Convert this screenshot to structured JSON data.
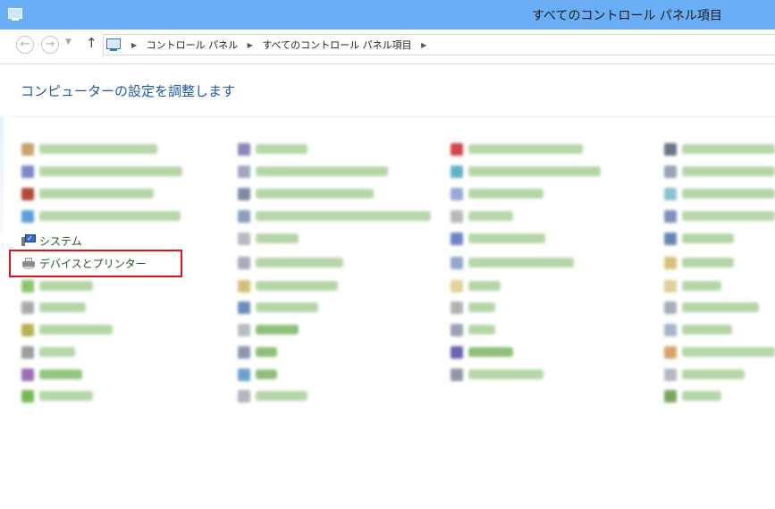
{
  "window": {
    "title": "すべてのコントロール パネル項目"
  },
  "nav": {
    "back_symbol": "←",
    "forward_symbol": "→",
    "dropdown_symbol": "▼",
    "up_symbol": "↑",
    "breadcrumb": [
      "コントロール パネル",
      "すべてのコントロール パネル項目"
    ],
    "separator": "▶"
  },
  "main": {
    "heading": "コンピューターの設定を調整します",
    "visible_items": {
      "system": "システム",
      "devices_and_printers": "デバイスとプリンター"
    }
  },
  "colors": {
    "titlebar": "#6aaef6",
    "heading": "#1d5aa8",
    "highlight": "#e0131d"
  }
}
